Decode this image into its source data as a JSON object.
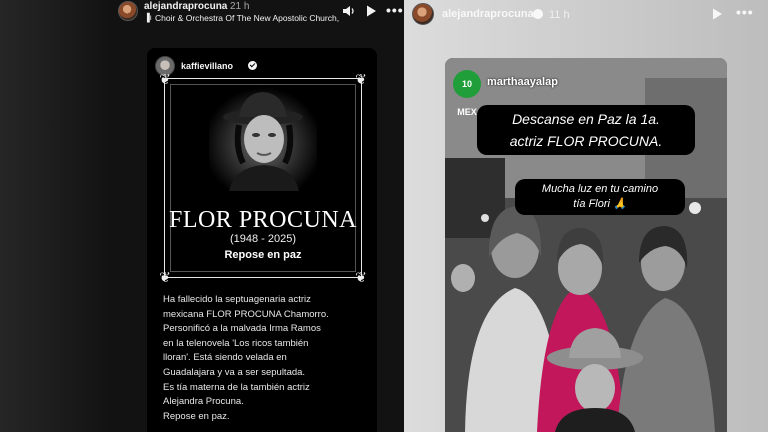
{
  "left_story": {
    "username": "alejandraprocuna",
    "timestamp": "21 h",
    "music": "Choir & Orchestra Of The New Apostolic Church,",
    "post": {
      "username": "kaffievillano",
      "obituary_name": "FLOR PROCUNA",
      "years": "(1948 - 2025)",
      "rest": "Repose en paz",
      "body_lines": [
        "Ha fallecido la septuagenaria actriz",
        "mexicana FLOR PROCUNA Chamorro.",
        "Personificó a la malvada Irma Ramos",
        "en la telenovela 'Los ricos también",
        "lloran'. Está siendo velada en",
        "Guadalajara y va a ser sepultada.",
        "Es tía materna de la también actriz",
        "Alejandra Procuna.",
        "Repose en paz."
      ]
    }
  },
  "right_story": {
    "username": "alejandraprocuna",
    "timestamp": "11 h",
    "photo": {
      "badge": "10 MEX",
      "username": "marthaayalap",
      "caption1_line1": "Descanse en Paz la 1a.",
      "caption1_line2": "actriz FLOR PROCUNA.",
      "caption2_line1": "Mucha luz en tu camino",
      "caption2_line2": "tía Flori 🙏"
    }
  },
  "colors": {
    "left_bg": "#121212",
    "right_bg": "#cfcfcf",
    "badge_green": "#1f9e3a",
    "pink_top": "#c2185b"
  },
  "icons": [
    "sound-icon",
    "play-icon",
    "more-icon",
    "verified-icon",
    "music-note-icon"
  ]
}
